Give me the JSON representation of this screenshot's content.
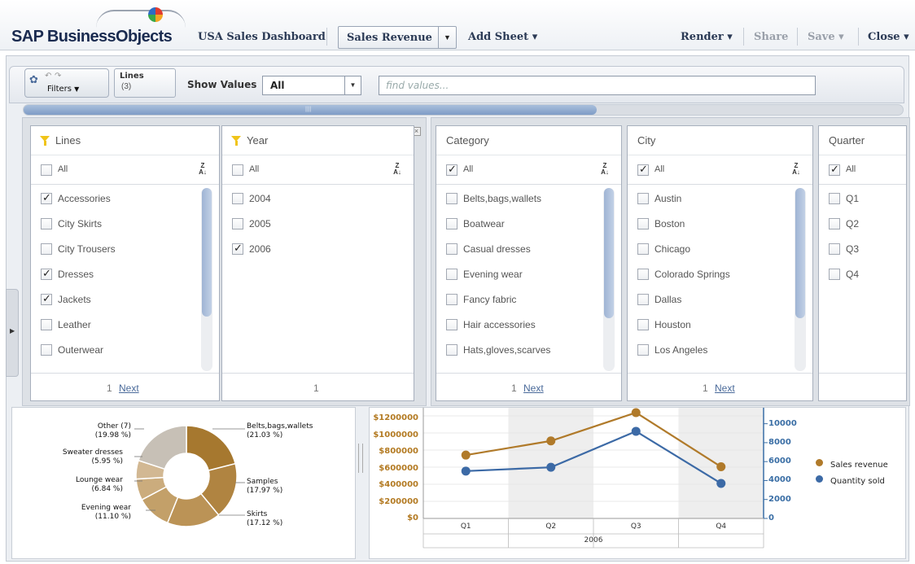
{
  "app": {
    "logo_text": "SAP BusinessObjects",
    "dashboard_title": "USA Sales Dashboard",
    "sheet": "Sales Revenue",
    "add_sheet": "Add Sheet",
    "render": "Render",
    "share": "Share",
    "save": "Save",
    "close": "Close"
  },
  "toolbar": {
    "filters_label": "Filters",
    "lines_tab_title": "Lines",
    "lines_tab_count": "(3)",
    "show_values_label": "Show Values",
    "show_values_selected": "All",
    "find_placeholder": "find values..."
  },
  "panels": {
    "lines": {
      "title": "Lines",
      "all_label": "All",
      "all_checked": false,
      "items": [
        {
          "label": "Accessories",
          "checked": true
        },
        {
          "label": "City Skirts",
          "checked": false
        },
        {
          "label": "City Trousers",
          "checked": false
        },
        {
          "label": "Dresses",
          "checked": true
        },
        {
          "label": "Jackets",
          "checked": true
        },
        {
          "label": "Leather",
          "checked": false
        },
        {
          "label": "Outerwear",
          "checked": false
        }
      ],
      "page": "1",
      "next": "Next"
    },
    "year": {
      "title": "Year",
      "all_label": "All",
      "all_checked": false,
      "items": [
        {
          "label": "2004",
          "checked": false
        },
        {
          "label": "2005",
          "checked": false
        },
        {
          "label": "2006",
          "checked": true
        }
      ],
      "page": "1"
    },
    "category": {
      "title": "Category",
      "all_label": "All",
      "all_checked": true,
      "items": [
        {
          "label": "Belts,bags,wallets",
          "checked": false
        },
        {
          "label": "Boatwear",
          "checked": false
        },
        {
          "label": "Casual dresses",
          "checked": false
        },
        {
          "label": "Evening wear",
          "checked": false
        },
        {
          "label": "Fancy fabric",
          "checked": false
        },
        {
          "label": "Hair accessories",
          "checked": false
        },
        {
          "label": "Hats,gloves,scarves",
          "checked": false
        }
      ],
      "page": "1",
      "next": "Next"
    },
    "city": {
      "title": "City",
      "all_label": "All",
      "all_checked": true,
      "items": [
        {
          "label": "Austin",
          "checked": false
        },
        {
          "label": "Boston",
          "checked": false
        },
        {
          "label": "Chicago",
          "checked": false
        },
        {
          "label": "Colorado Springs",
          "checked": false
        },
        {
          "label": "Dallas",
          "checked": false
        },
        {
          "label": "Houston",
          "checked": false
        },
        {
          "label": "Los Angeles",
          "checked": false
        }
      ],
      "page": "1",
      "next": "Next"
    },
    "quarter": {
      "title": "Quarter",
      "all_label": "All",
      "all_checked": true,
      "items": [
        {
          "label": "Q1",
          "checked": false
        },
        {
          "label": "Q2",
          "checked": false
        },
        {
          "label": "Q3",
          "checked": false
        },
        {
          "label": "Q4",
          "checked": false
        }
      ]
    }
  },
  "colors": {
    "sales_revenue": "#b07a2a",
    "quantity_sold": "#3c6aa6"
  },
  "chart_data": [
    {
      "type": "pie",
      "categories": [
        "Belts,bags,wallets",
        "Samples",
        "Skirts",
        "Evening wear",
        "Lounge wear",
        "Sweater dresses",
        "Other (7)"
      ],
      "values": [
        21.03,
        17.97,
        17.12,
        11.1,
        6.84,
        5.95,
        19.98
      ],
      "labels": [
        "(21.03 %)",
        "(17.97 %)",
        "(17.12 %)",
        "(11.10 %)",
        "(6.84 %)",
        "(5.95 %)",
        "(19.98 %)"
      ],
      "colors": [
        "#a6782f",
        "#b08441",
        "#bb9356",
        "#c3a069",
        "#cbac7d",
        "#d2b893",
        "#c7c0b6"
      ]
    },
    {
      "type": "line",
      "categories": [
        "Q1",
        "Q2",
        "Q3",
        "Q4"
      ],
      "group_label": "2006",
      "y_ticks": [
        "$0",
        "$200000",
        "$400000",
        "$600000",
        "$800000",
        "$1000000",
        "$1200000"
      ],
      "y2_ticks": [
        "0",
        "2000",
        "4000",
        "6000",
        "8000",
        "10000"
      ],
      "ylim": [
        0,
        1250000
      ],
      "y2lim": [
        0,
        11000
      ],
      "series": [
        {
          "name": "Sales revenue",
          "axis": "left",
          "values": [
            760000,
            930000,
            1270000,
            620000
          ]
        },
        {
          "name": "Quantity sold",
          "axis": "right",
          "values": [
            5000,
            5400,
            9200,
            3700
          ]
        }
      ]
    }
  ]
}
